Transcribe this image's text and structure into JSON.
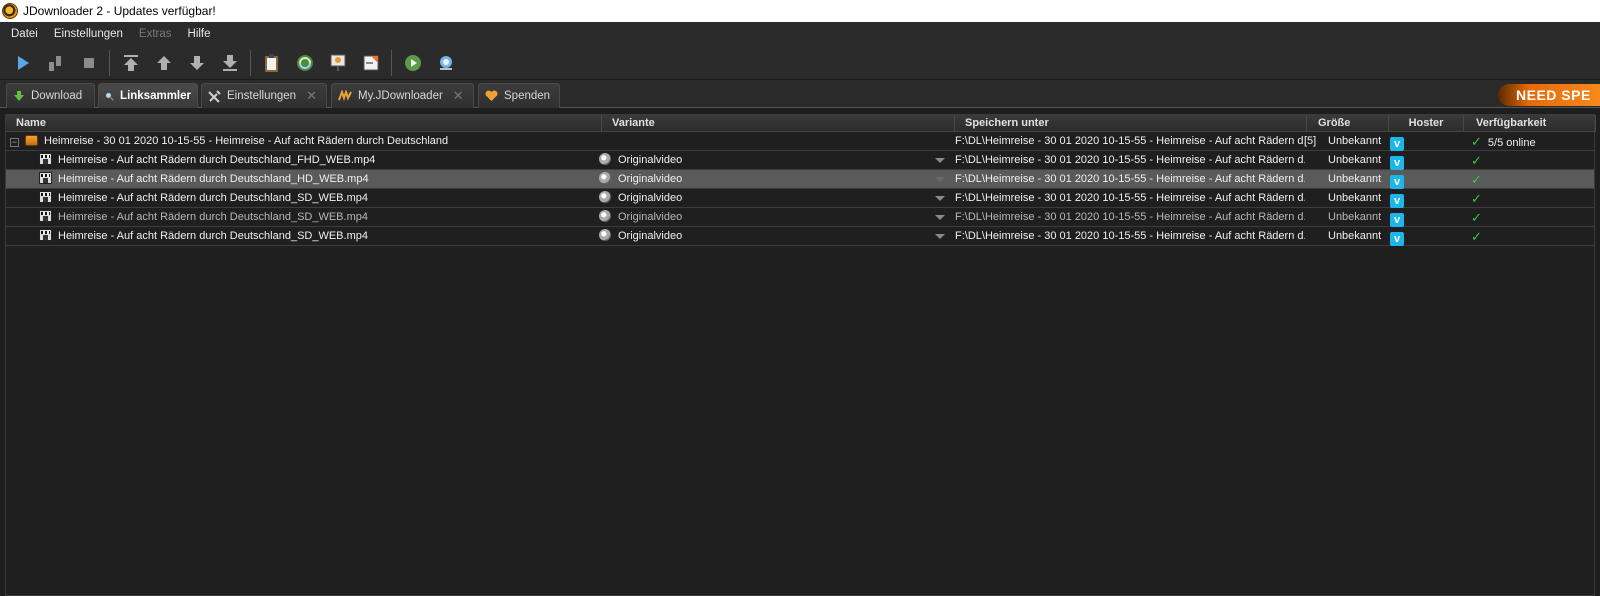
{
  "window": {
    "title": "JDownloader 2 - Updates verfügbar!"
  },
  "menu": [
    {
      "label": "Datei",
      "disabled": false
    },
    {
      "label": "Einstellungen",
      "disabled": false
    },
    {
      "label": "Extras",
      "disabled": true
    },
    {
      "label": "Hilfe",
      "disabled": false
    }
  ],
  "toolbar": {
    "buttons": [
      "play-icon",
      "pause-icon",
      "stop-icon",
      "move-top-icon",
      "move-up-icon",
      "move-down-icon",
      "move-bottom-icon",
      "clipboard-icon",
      "reconnect-icon",
      "premium-icon",
      "silent-mode-icon",
      "update-icon",
      "online-check-icon"
    ]
  },
  "tabs": [
    {
      "label": "Download",
      "icon": "download-arrow-icon",
      "closable": false,
      "active": false
    },
    {
      "label": "Linksammler",
      "icon": "linkgrabber-icon",
      "closable": false,
      "active": true
    },
    {
      "label": "Einstellungen",
      "icon": "wrench-icon",
      "closable": true,
      "active": false
    },
    {
      "label": "My.JDownloader",
      "icon": "myjd-icon",
      "closable": true,
      "active": false
    },
    {
      "label": "Spenden",
      "icon": "heart-icon",
      "closable": false,
      "active": false
    }
  ],
  "banner": {
    "label": "NEED SPE"
  },
  "table": {
    "columns": {
      "name": "Name",
      "variant": "Variante",
      "save_to": "Speichern unter",
      "size": "Größe",
      "hoster": "Hoster",
      "availability": "Verfügbarkeit"
    },
    "package": {
      "name": "Heimreise - 30 01 2020 10-15-55 - Heimreise - Auf acht Rädern durch Deutschland",
      "save_to": "F:\\DL\\Heimreise - 30 01 2020 10-15-55 - Heimreise - Auf acht Rädern d...",
      "count": "[5]",
      "size": "Unbekannt",
      "hoster": "v",
      "availability": "5/5 online"
    },
    "rows": [
      {
        "name": "Heimreise - Auf acht Rädern durch Deutschland_FHD_WEB.mp4",
        "variant": "Originalvideo",
        "save_to": "F:\\DL\\Heimreise - 30 01 2020 10-15-55 - Heimreise - Auf acht Rädern d...",
        "size": "Unbekannt",
        "hoster": "v",
        "selected": false,
        "dim": false
      },
      {
        "name": "Heimreise - Auf acht Rädern durch Deutschland_HD_WEB.mp4",
        "variant": "Originalvideo",
        "save_to": "F:\\DL\\Heimreise - 30 01 2020 10-15-55 - Heimreise - Auf acht Rädern d...",
        "size": "Unbekannt",
        "hoster": "v",
        "selected": true,
        "dim": false
      },
      {
        "name": "Heimreise - Auf acht Rädern durch Deutschland_SD_WEB.mp4",
        "variant": "Originalvideo",
        "save_to": "F:\\DL\\Heimreise - 30 01 2020 10-15-55 - Heimreise - Auf acht Rädern d...",
        "size": "Unbekannt",
        "hoster": "v",
        "selected": false,
        "dim": false
      },
      {
        "name": "Heimreise - Auf acht Rädern durch Deutschland_SD_WEB.mp4",
        "variant": "Originalvideo",
        "save_to": "F:\\DL\\Heimreise - 30 01 2020 10-15-55 - Heimreise - Auf acht Rädern d...",
        "size": "Unbekannt",
        "hoster": "v",
        "selected": false,
        "dim": true
      },
      {
        "name": "Heimreise - Auf acht Rädern durch Deutschland_SD_WEB.mp4",
        "variant": "Originalvideo",
        "save_to": "F:\\DL\\Heimreise - 30 01 2020 10-15-55 - Heimreise - Auf acht Rädern d...",
        "size": "Unbekannt",
        "hoster": "v",
        "selected": false,
        "dim": false
      }
    ]
  }
}
